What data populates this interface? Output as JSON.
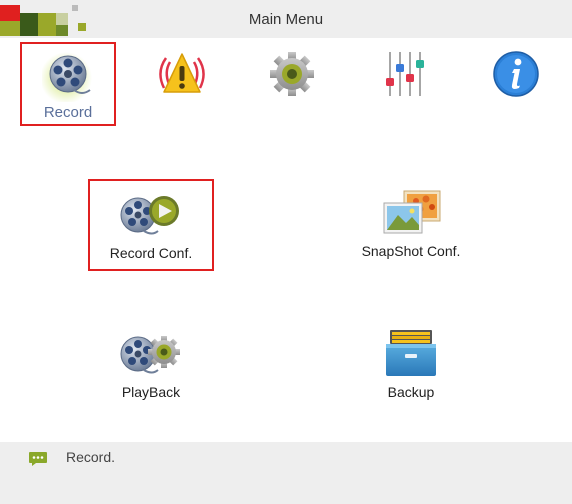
{
  "window": {
    "title": "Main Menu"
  },
  "tabs": [
    {
      "label": "Record",
      "icon": "record-reel-icon",
      "selected": true
    },
    {
      "label": "Alarm",
      "icon": "alarm-warning-icon",
      "selected": false
    },
    {
      "label": "System",
      "icon": "system-gear-icon",
      "selected": false
    },
    {
      "label": "Advanced",
      "icon": "advanced-sliders-icon",
      "selected": false
    },
    {
      "label": "Info",
      "icon": "info-icon",
      "selected": false
    }
  ],
  "items": [
    {
      "label": "Record Conf.",
      "icon": "record-conf-icon",
      "selected": true
    },
    {
      "label": "SnapShot Conf.",
      "icon": "snapshot-pictures-icon",
      "selected": false
    },
    {
      "label": "PlayBack",
      "icon": "playback-reel-gear-icon",
      "selected": false
    },
    {
      "label": "Backup",
      "icon": "backup-cabinet-icon",
      "selected": false
    }
  ],
  "status": {
    "text": "Record.",
    "icon": "chat-bubble-icon"
  },
  "colors": {
    "selection_border": "#e02020",
    "titlebar_bg": "#eeeeee",
    "selected_tab_text": "#5a6f9a"
  }
}
